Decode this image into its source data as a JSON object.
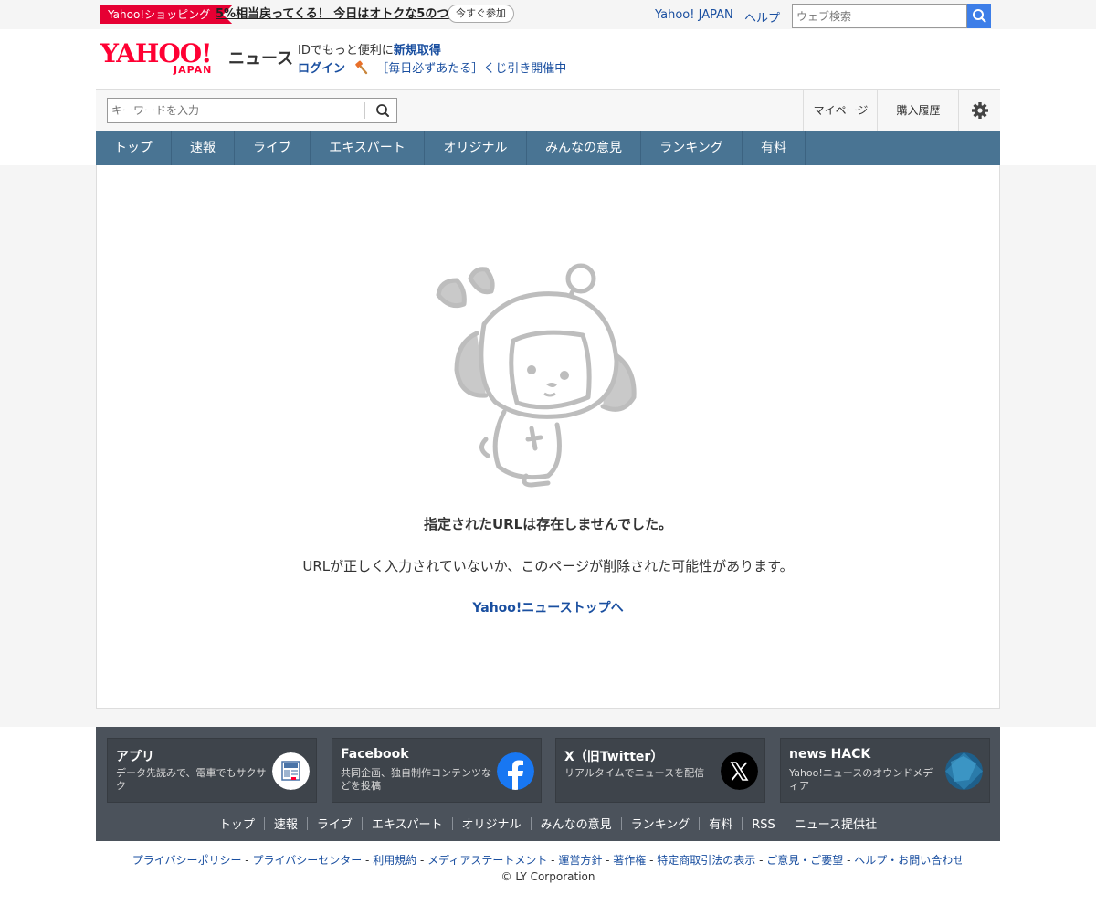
{
  "topbar": {
    "promo_tag": "Yahoo!ショッピング",
    "promo_text": "5%相当戻ってくる！ 今日はオトクな5のつく日",
    "promo_button": "今すぐ参加",
    "links": [
      "Yahoo! JAPAN",
      "ヘルプ"
    ],
    "web_search_placeholder": "ウェブ検索"
  },
  "header": {
    "logo_main": "YAHOO!",
    "logo_sub": "JAPAN",
    "service_name": "ニュース",
    "id_text": "IDでもっと便利に",
    "id_link": "新規取得",
    "login": "ログイン",
    "lottery": "［毎日必ずあたる］くじ引き開催中"
  },
  "search": {
    "placeholder": "キーワードを入力",
    "mypage": "マイページ",
    "history": "購入履歴"
  },
  "nav": {
    "items": [
      "トップ",
      "速報",
      "ライブ",
      "エキスパート",
      "オリジナル",
      "みんなの意見",
      "ランキング",
      "有料"
    ]
  },
  "error": {
    "title": "指定されたURLは存在しませんでした。",
    "description": "URLが正しく入力されていないか、このページが削除された可能性があります。",
    "link": "Yahoo!ニューストップへ"
  },
  "footer": {
    "cards": [
      {
        "title": "アプリ",
        "desc": "データ先読みで、電車でもサクサク",
        "icon": "app-icon"
      },
      {
        "title": "Facebook",
        "desc": "共同企画、独自制作コンテンツなどを投稿",
        "icon": "facebook-icon"
      },
      {
        "title": "X（旧Twitter）",
        "desc": "リアルタイムでニュースを配信",
        "icon": "x-icon"
      },
      {
        "title": "news HACK",
        "desc": "Yahoo!ニュースのオウンドメディア",
        "icon": "news-hack-icon"
      }
    ],
    "links": [
      "トップ",
      "速報",
      "ライブ",
      "エキスパート",
      "オリジナル",
      "みんなの意見",
      "ランキング",
      "有料",
      "RSS",
      "ニュース提供社"
    ],
    "legal": [
      "プライバシーポリシー",
      "プライバシーセンター",
      "利用規約",
      "メディアステートメント",
      "運営方針",
      "著作権",
      "特定商取引法の表示",
      "ご意見・ご要望",
      "ヘルプ・お問い合わせ"
    ],
    "copyright": "© LY Corporation"
  },
  "colors": {
    "accent_red": "#e60033",
    "link_blue": "#1a4fa0",
    "nav_blue": "#497493",
    "footer_dark": "#4b525b"
  }
}
